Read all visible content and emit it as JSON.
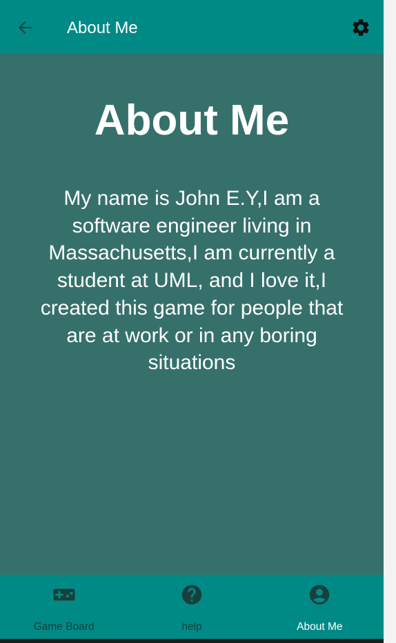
{
  "colors": {
    "app_bar": "#008a86",
    "content_background": "#36706b",
    "bottom_nav": "#008a86",
    "inactive_nav": "#173f3d",
    "active_nav": "#ffffff",
    "text": "#ffffff"
  },
  "app_bar": {
    "back_icon": "arrow-back-icon",
    "title": "About Me",
    "settings_icon": "gear-icon"
  },
  "main": {
    "heading": "About Me",
    "bio": "My name is John E.Y,I am a software engineer living in Massachusetts,I am currently a student at UML, and I love it,I created this game for people that are at work or in any boring situations"
  },
  "bottom_nav": {
    "items": [
      {
        "label": "Game Board",
        "icon": "gamepad-icon",
        "active": false
      },
      {
        "label": "help",
        "icon": "help-icon",
        "active": false
      },
      {
        "label": "About Me",
        "icon": "account-circle-icon",
        "active": true
      }
    ]
  }
}
